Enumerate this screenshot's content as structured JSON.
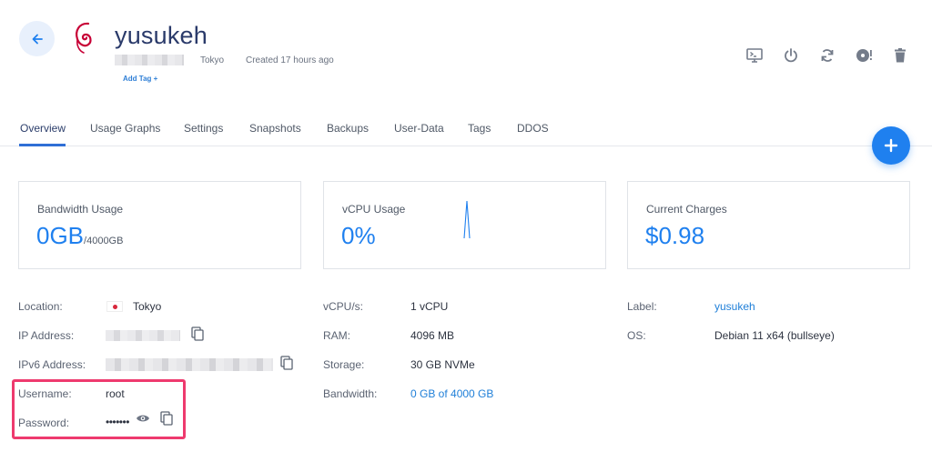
{
  "server": {
    "name": "yusukeh",
    "location": "Tokyo",
    "created": "Created 17 hours ago",
    "add_tag": "Add Tag +"
  },
  "actions": [
    "console-icon",
    "power-icon",
    "restart-icon",
    "reinstall-icon",
    "trash-icon"
  ],
  "tabs": [
    {
      "label": "Overview",
      "active": true
    },
    {
      "label": "Usage Graphs"
    },
    {
      "label": "Settings"
    },
    {
      "label": "Snapshots"
    },
    {
      "label": "Backups"
    },
    {
      "label": "User-Data"
    },
    {
      "label": "Tags"
    },
    {
      "label": "DDOS"
    }
  ],
  "cards": {
    "bandwidth": {
      "label": "Bandwidth Usage",
      "value": "0GB",
      "sub": "/4000GB"
    },
    "vcpu": {
      "label": "vCPU Usage",
      "value": "0%"
    },
    "charges": {
      "label": "Current Charges",
      "value": "$0.98"
    }
  },
  "info": {
    "location_label": "Location:",
    "location_value": "Tokyo",
    "ip_label": "IP Address:",
    "ipv6_label": "IPv6 Address:",
    "username_label": "Username:",
    "username_value": "root",
    "password_label": "Password:",
    "password_value": "•••••••",
    "vcpus_label": "vCPU/s:",
    "vcpus_value": "1 vCPU",
    "ram_label": "RAM:",
    "ram_value": "4096 MB",
    "storage_label": "Storage:",
    "storage_value": "30 GB NVMe",
    "bandwidth_label": "Bandwidth:",
    "bandwidth_value": "0 GB of 4000 GB",
    "label_label": "Label:",
    "label_value": "yusukeh",
    "os_label": "OS:",
    "os_value": "Debian 11 x64 (bullseye)"
  },
  "colors": {
    "accent": "#1f80ef",
    "highlight": "#ee3a6e",
    "debian": "#c70036"
  }
}
